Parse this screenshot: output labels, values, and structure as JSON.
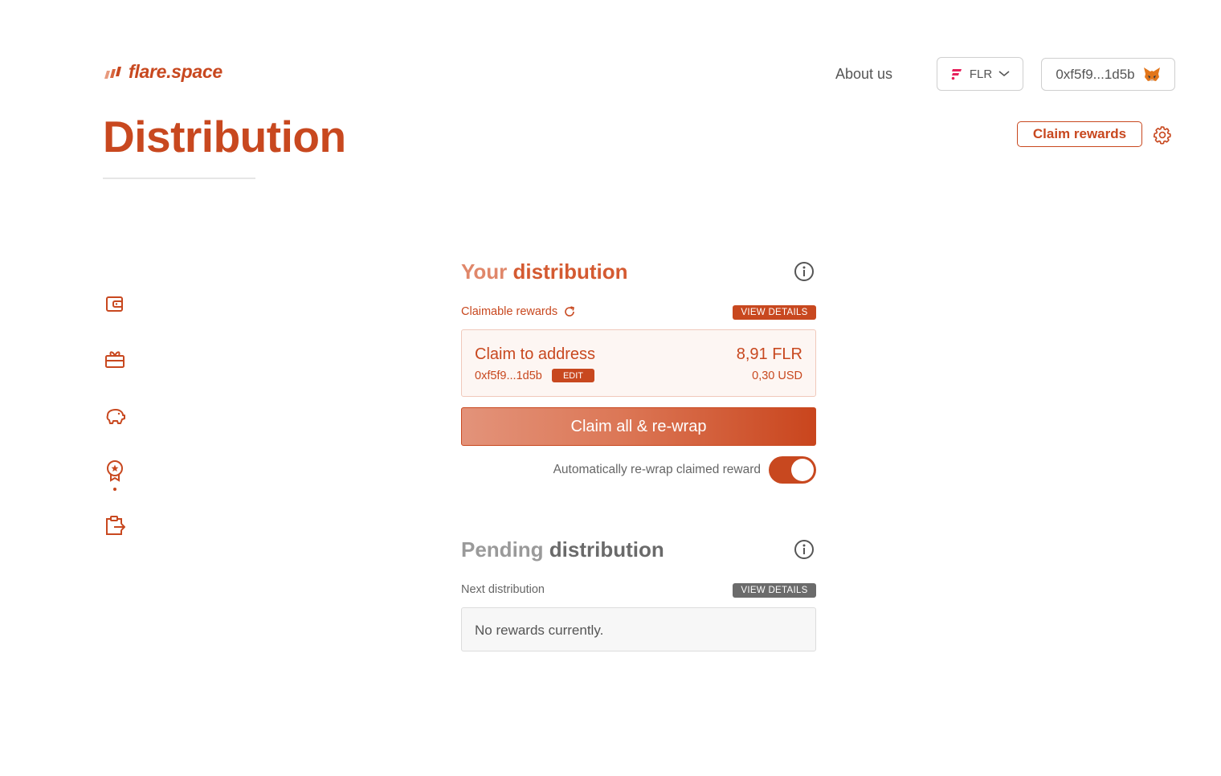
{
  "header": {
    "logo_text": "flare.space",
    "about_label": "About us",
    "network": {
      "label": "FLR",
      "icon": "flare-logo-icon"
    },
    "wallet": {
      "address": "0xf5f9...1d5b",
      "icon": "metamask-fox-icon"
    }
  },
  "page": {
    "title": "Distribution",
    "claim_rewards_label": "Claim rewards"
  },
  "sidebar": {
    "items": [
      {
        "icon": "wallet-icon"
      },
      {
        "icon": "gift-icon"
      },
      {
        "icon": "piggy-bank-icon"
      },
      {
        "icon": "award-ribbon-icon",
        "active": true
      },
      {
        "icon": "clipboard-export-icon"
      }
    ]
  },
  "your_distribution": {
    "title_light": "Your",
    "title_bold": "distribution",
    "claimable_label": "Claimable rewards",
    "view_details_label": "VIEW DETAILS",
    "card": {
      "title": "Claim to address",
      "address": "0xf5f9...1d5b",
      "edit_label": "EDIT",
      "amount": "8,91 FLR",
      "usd": "0,30 USD"
    },
    "claim_button_label": "Claim all & re-wrap",
    "auto_rewrap_label": "Automatically re-wrap claimed reward",
    "auto_rewrap_enabled": true
  },
  "pending_distribution": {
    "title_light": "Pending",
    "title_bold": "distribution",
    "next_label": "Next distribution",
    "view_details_label": "VIEW DETAILS",
    "empty_text": "No rewards currently."
  },
  "colors": {
    "brand": "#c8481f",
    "muted_badge": "#6b6b6b"
  }
}
